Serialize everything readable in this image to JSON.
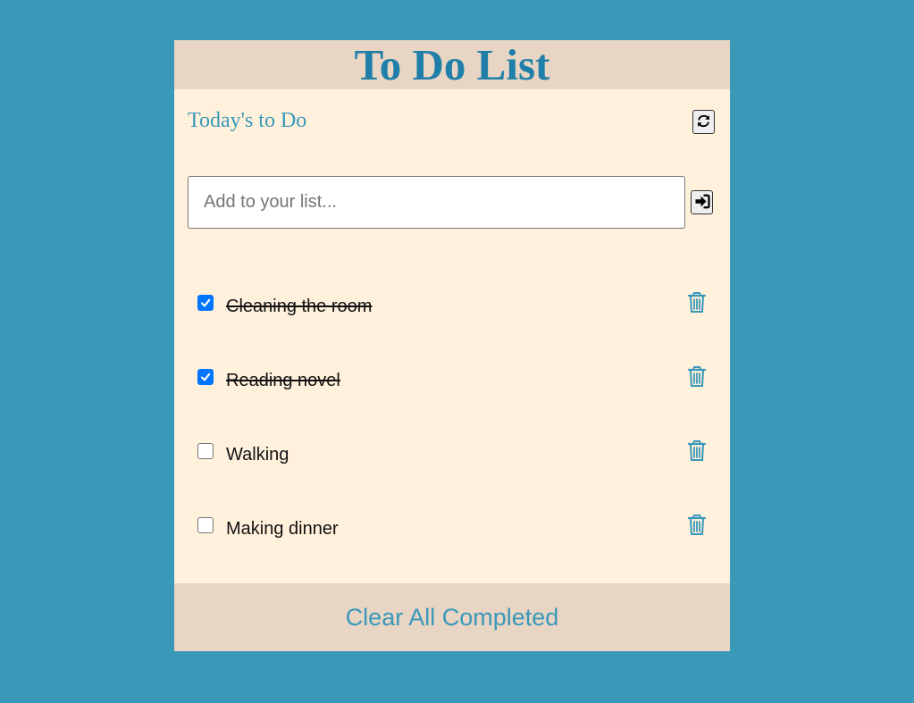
{
  "header": {
    "title": "To Do List"
  },
  "subheader": {
    "label": "Today's to Do",
    "refresh_icon": "refresh-icon"
  },
  "add_form": {
    "placeholder": "Add to your list...",
    "value": "",
    "enter_icon": "sign-in-icon"
  },
  "items": [
    {
      "label": "Cleaning the room",
      "completed": true,
      "delete_icon": "trash-icon"
    },
    {
      "label": "Reading novel",
      "completed": true,
      "delete_icon": "trash-icon"
    },
    {
      "label": "Walking",
      "completed": false,
      "delete_icon": "trash-icon"
    },
    {
      "label": "Making dinner",
      "completed": false,
      "delete_icon": "trash-icon"
    }
  ],
  "footer": {
    "clear_label": "Clear All Completed"
  },
  "colors": {
    "background": "#3a98b9",
    "panel": "#fff1dc",
    "bar": "#e8d5c4",
    "accent": "#3a98b9",
    "title": "#1f7fa8",
    "checkbox_checked": "#0075ff"
  }
}
